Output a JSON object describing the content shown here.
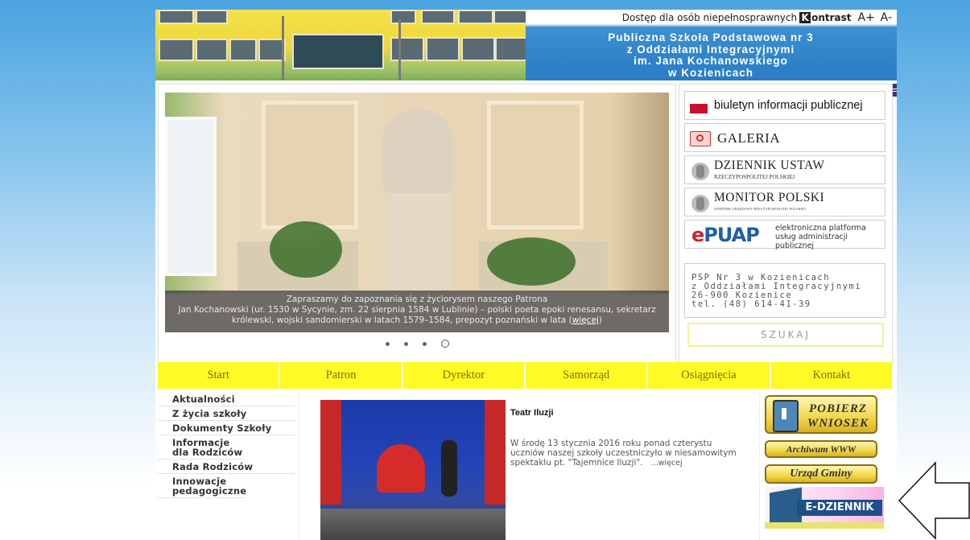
{
  "header": {
    "accessibility_text": "Dostęp dla osób niepełnosprawnych",
    "contrast_k": "K",
    "contrast_rest": "ontrast",
    "font_increase": "A+",
    "font_decrease": "A-",
    "school_name_lines": [
      "Publiczna Szkoła Podstawowa nr 3",
      "z Oddziałami Integracyjnymi",
      "im. Jana Kochanowskiego",
      "w Kozienicach"
    ]
  },
  "slider": {
    "caption_lead": "Zapraszamy do zapoznania się z życiorysem naszego Patrona",
    "caption_body": "Jan Kochanowski (ur. 1530 w Sycynie, zm. 22 sierpnia 1584 w Lublinie) – polski poeta epoki renesansu, sekretarz królewski, wojski sandomierski w latach 1579–1584, prepozyt poznański w lata (",
    "caption_link": "więcej",
    "caption_end": ")",
    "dots": 4,
    "active_dot": 4
  },
  "side_links": {
    "bip": "biuletyn informacji publicznej",
    "bip_icon": "bip",
    "galeria": "GALERIA",
    "dziennik_title": "DZIENNIK USTAW",
    "dziennik_sub": "RZECZYPOSPOLITEJ POLSKIEJ",
    "monitor_title": "MONITOR POLSKI",
    "monitor_sub": "DZIENNIK URZĘDOWY RZECZYPOSPOLITEJ POLSKIEJ",
    "epuap_e": "e",
    "epuap_rest": "PUAP",
    "epuap_text_line1": "elektroniczna platforma",
    "epuap_text_line2": "usług administracji publicznej",
    "address": "PSP Nr 3 w Kozienicach\nz Oddziałami Integracyjnymi\n26-900 Kozienice\ntel. (48) 614-41-39",
    "search_label": "SZUKAJ"
  },
  "nav": [
    "Start",
    "Patron",
    "Dyrektor",
    "Samorząd",
    "Osiągnięcia",
    "Kontakt"
  ],
  "left_menu": [
    "Aktualności",
    "Z życia szkoły",
    "Dokumenty Szkoły",
    "Informacje dla Rodziców",
    "Rada Rodziców",
    "Innowacje pedagogiczne"
  ],
  "news": {
    "title": "Teatr Iluzji",
    "body": "W środę 13 stycznia 2016 roku ponad czterystu uczniów naszej szkoły uczestniczyło w niesamowitym spektaklu pt. \"Tajemnice Iluzji\".",
    "more": "...więcej"
  },
  "banners": {
    "pobierz": "POBIERZ WNIOSEK",
    "archiwum": "Archiwum WWW",
    "urzad": "Urząd Gminy",
    "edziennik": "E-DZIENNIK"
  },
  "colors": {
    "nav_bg": "#fdfa24",
    "nav_text": "#8a6a10",
    "header_blue": "#2a7cc4"
  }
}
